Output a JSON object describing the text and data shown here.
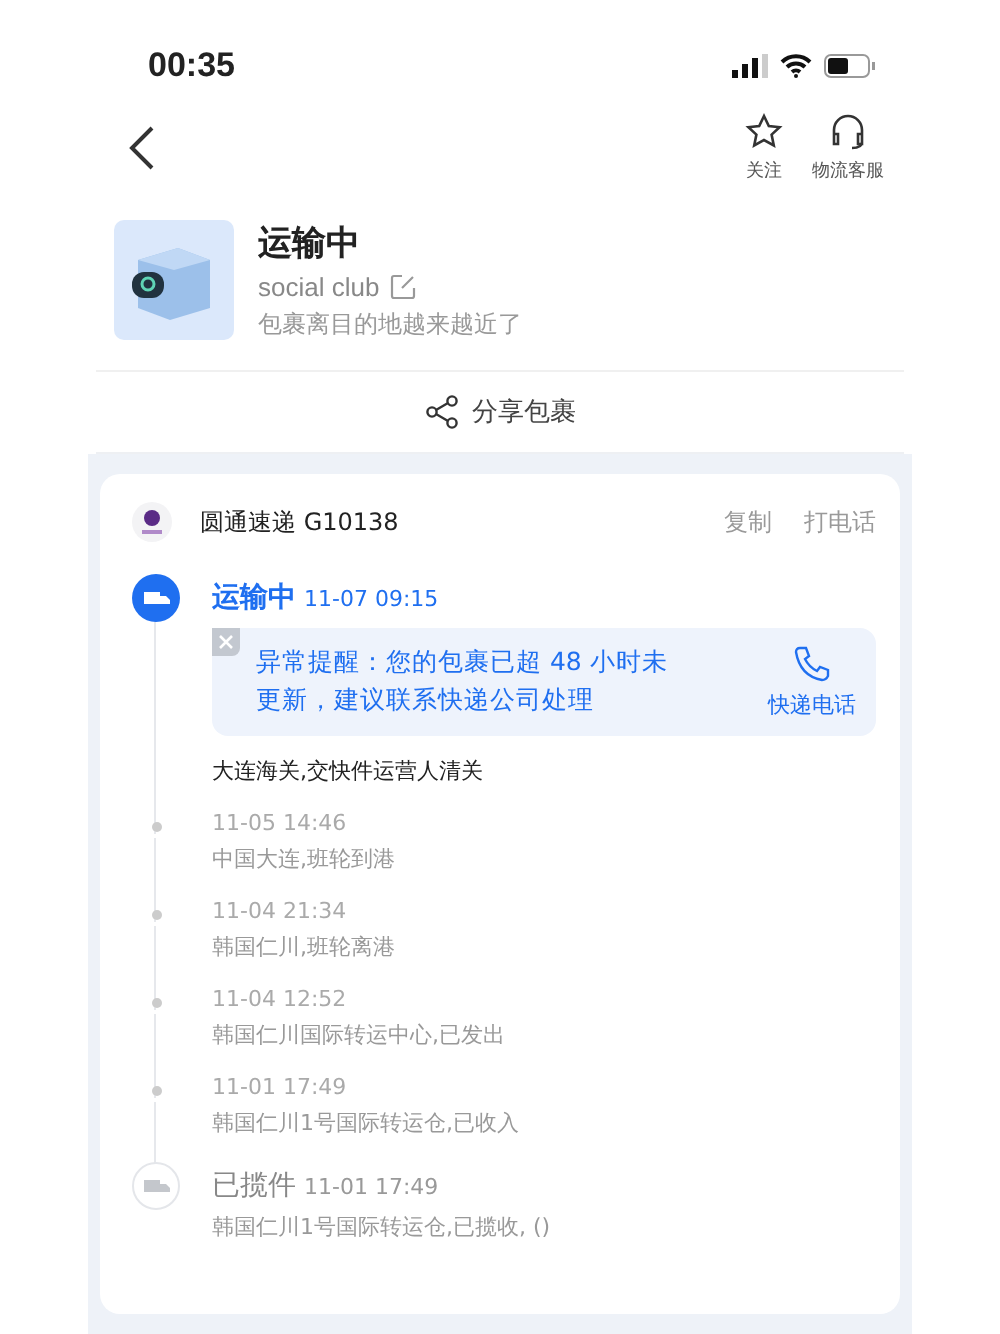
{
  "status_bar": {
    "time": "00:35"
  },
  "nav": {
    "actions": [
      {
        "kind": "star",
        "label": "关注"
      },
      {
        "kind": "headset",
        "label": "物流客服"
      }
    ]
  },
  "package": {
    "status": "运输中",
    "name": "social club",
    "subtitle": "包裹离目的地越来越近了"
  },
  "share": {
    "label": "分享包裹"
  },
  "courier": {
    "name": "圆通速递 G10138",
    "actions": [
      "复制",
      "打电话"
    ]
  },
  "events": [
    {
      "kind": "major",
      "active": true,
      "status": "运输中",
      "time": "11-07 09:15",
      "alert": {
        "text": "异常提醒：您的包裹已超 48 小时未更新，建议联系快递公司处理",
        "action": "快递电话"
      },
      "description": "大连海关,交快件运营人清关"
    },
    {
      "kind": "minor",
      "time": "11-05 14:46",
      "description": "中国大连,班轮到港"
    },
    {
      "kind": "minor",
      "time": "11-04 21:34",
      "description": "韩国仁川,班轮离港"
    },
    {
      "kind": "minor",
      "time": "11-04 12:52",
      "description": "韩国仁川国际转运中心,已发出"
    },
    {
      "kind": "minor",
      "time": "11-01 17:49",
      "description": "韩国仁川1号国际转运仓,已收入"
    },
    {
      "kind": "major",
      "active": false,
      "status": "已揽件",
      "time": "11-01 17:49",
      "description": "韩国仁川1号国际转运仓,已揽收, ()"
    }
  ]
}
